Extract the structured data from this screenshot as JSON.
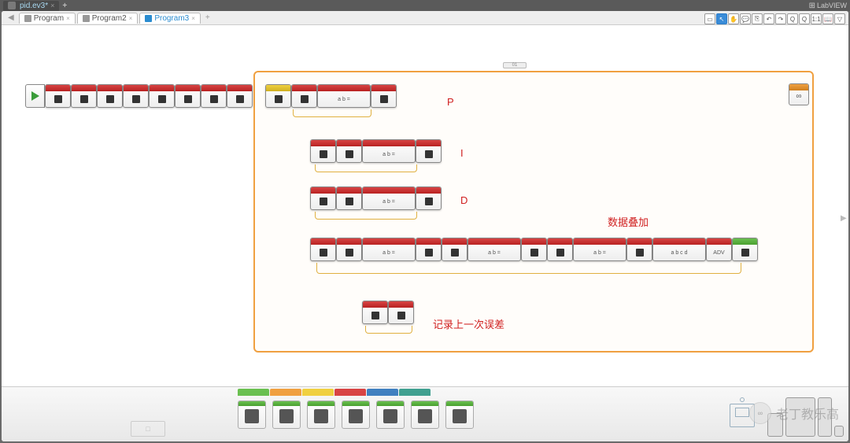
{
  "topbar": {
    "project_tab": "pid.ev3*",
    "close": "×",
    "plus": "+",
    "labview": "LabVIEW"
  },
  "subtabs": [
    {
      "label": "Program",
      "active": false
    },
    {
      "label": "Program2",
      "active": false
    },
    {
      "label": "Program3",
      "active": true
    }
  ],
  "toolbar": {
    "items": [
      "□",
      "▶",
      "□",
      "⎘",
      "↺",
      "↻",
      "⤢",
      "Q",
      "Q",
      "1:1",
      "📖",
      "▽"
    ]
  },
  "canvas": {
    "loop_count": "01",
    "loop_infinity": "∞",
    "labels": {
      "p": "P",
      "i": "I",
      "d": "D",
      "sum": "数据叠加",
      "record": "记录上一次误差"
    }
  },
  "palette": {
    "tabs": [
      "green",
      "orange",
      "yellow",
      "red",
      "blue",
      "teal"
    ],
    "item_count": 7
  },
  "watermark": {
    "icon": "∞",
    "text": "老丁教乐高"
  },
  "surface": "□"
}
